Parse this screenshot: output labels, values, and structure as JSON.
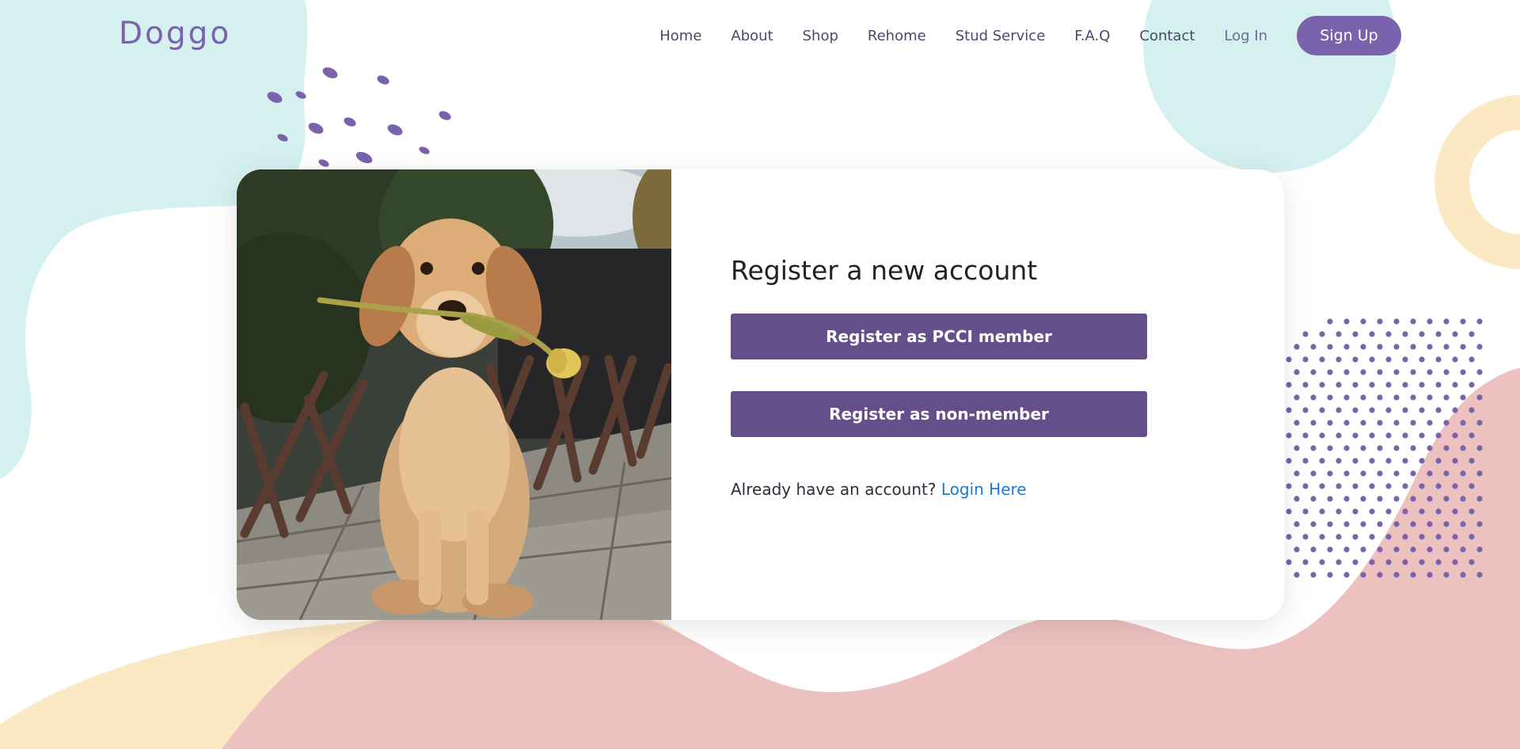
{
  "brand": {
    "name": "Doggo"
  },
  "nav": {
    "links": [
      "Home",
      "About",
      "Shop",
      "Rehome",
      "Stud Service",
      "F.A.Q",
      "Contact"
    ],
    "login": "Log In",
    "signup": "Sign Up"
  },
  "register": {
    "title": "Register a new account",
    "pcci_button": "Register as PCCI member",
    "nonmember_button": "Register as non-member",
    "existing_prompt": "Already have an account?",
    "login_link": "Login Here"
  },
  "colors": {
    "accent": "#7b62ad",
    "button": "#644f8a",
    "link": "#1a7ad6",
    "teal": "#d4f0ef",
    "pink": "#ecc1bf",
    "cream": "#fbe9c4"
  }
}
